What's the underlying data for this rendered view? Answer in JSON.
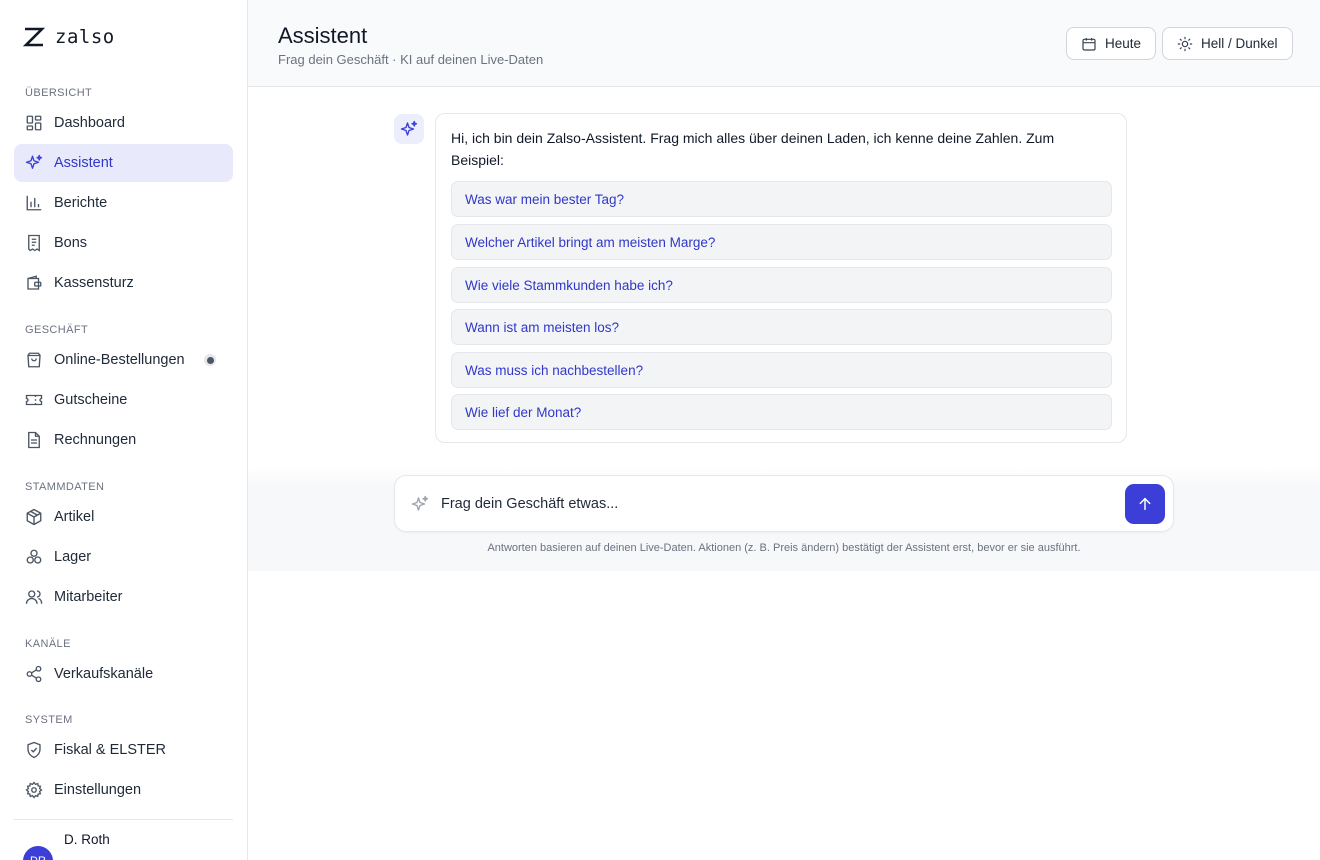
{
  "brand": {
    "name": "zalso"
  },
  "sidebar": {
    "sections": [
      {
        "title": "ÜBERSICHT",
        "items": [
          {
            "label": "Dashboard",
            "icon": "grid-icon",
            "active": false
          },
          {
            "label": "Assistent",
            "icon": "sparkles-icon",
            "active": true
          },
          {
            "label": "Berichte",
            "icon": "bar-chart-icon",
            "active": false
          },
          {
            "label": "Bons",
            "icon": "receipt-icon",
            "active": false
          },
          {
            "label": "Kassensturz",
            "icon": "wallet-icon",
            "active": false
          }
        ]
      },
      {
        "title": "GESCHÄFT",
        "items": [
          {
            "label": "Online-Bestellungen",
            "icon": "shopping-bag-icon",
            "active": false,
            "indicator": true
          },
          {
            "label": "Gutscheine",
            "icon": "ticket-icon",
            "active": false
          },
          {
            "label": "Rechnungen",
            "icon": "file-text-icon",
            "active": false
          }
        ]
      },
      {
        "title": "STAMMDATEN",
        "items": [
          {
            "label": "Artikel",
            "icon": "package-icon",
            "active": false
          },
          {
            "label": "Lager",
            "icon": "boxes-icon",
            "active": false
          },
          {
            "label": "Mitarbeiter",
            "icon": "users-icon",
            "active": false
          }
        ]
      },
      {
        "title": "KANÄLE",
        "items": [
          {
            "label": "Verkaufskanäle",
            "icon": "share-icon",
            "active": false
          }
        ]
      },
      {
        "title": "SYSTEM",
        "items": [
          {
            "label": "Fiskal & ELSTER",
            "icon": "shield-check-icon",
            "active": false
          },
          {
            "label": "Einstellungen",
            "icon": "gear-icon",
            "active": false
          }
        ]
      }
    ],
    "user": {
      "name": "D. Roth",
      "initials": "DR"
    }
  },
  "header": {
    "title": "Assistent",
    "subtitle": "Frag dein Geschäft · KI auf deinen Live-Daten",
    "today_label": "Heute",
    "theme_label": "Hell / Dunkel"
  },
  "chat": {
    "greeting": "Hi, ich bin dein Zalso-Assistent. Frag mich alles über deinen Laden, ich kenne deine Zahlen. Zum Beispiel:",
    "suggestions": [
      "Was war mein bester Tag?",
      "Welcher Artikel bringt am meisten Marge?",
      "Wie viele Stammkunden habe ich?",
      "Wann ist am meisten los?",
      "Was muss ich nachbestellen?",
      "Wie lief der Monat?"
    ]
  },
  "composer": {
    "placeholder": "Frag dein Geschäft etwas...",
    "disclaimer": "Antworten basieren auf deinen Live-Daten. Aktionen (z. B. Preis ändern) bestätigt der Assistent erst, bevor er sie ausführt."
  },
  "colors": {
    "accent": "#3b3fd8",
    "active_bg": "#e8e9fb",
    "border": "#e5e7eb"
  }
}
